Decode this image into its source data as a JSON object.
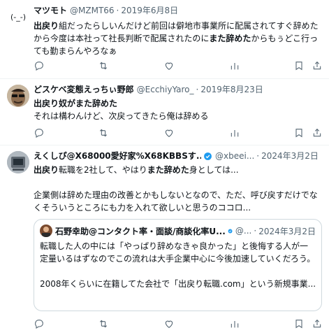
{
  "tweets": [
    {
      "display_name": "マツモト",
      "handle": "@MZMT66",
      "date": "2019年6月8日",
      "avatar_text": "(-_-)",
      "text_pre": "",
      "text_b1": "出戻り",
      "text_mid": "組だったらしいんだけど前回は僻地市事業所に配属されてすぐ辞めたから今度は本社って社長判断で配属されたのに",
      "text_b2": "また辞めた",
      "text_post": "からもぅどこ行っても勤まらんやろなぁ"
    },
    {
      "display_name": "どスケベ変態えっちぃ野郎",
      "handle": "@EcchiyYaro_",
      "date": "2019年8月23日",
      "line1_b1": "出戻り",
      "line1_mid": "奴が",
      "line1_b2": "また辞めた",
      "line2": "それは構わんけど、次戻ってきたら俺は辞める"
    },
    {
      "display_name": "えくしぴ@X68000愛好家%X68KBBSす...",
      "handle": "@xbeei...",
      "date": "2024年3月2日",
      "line1_b1": "出戻り",
      "line1_mid": "転職を2社して、やはり",
      "line1_b2": "また辞めた",
      "line1_post": "身としては...",
      "para2": "企業側は辞めた理由の改善とかもしないとなので、ただ、呼び戻すだけでなくそういうところにも力を入れて欲しいと思うのココロ...",
      "quote": {
        "display_name": "石野幸助@コンタクト率・面談/商談化率U...",
        "handle": "@...",
        "date": "2024年3月2日",
        "text1": "転職した人の中には「やっぱり辞めなきゃ良かった」と後悔する人が一定量いるはずなのでこの流れは大手企業中心に今後加速していくだろう。",
        "text2": "2008年くらいに在籍してた会社で「出戻り転職.com」という新規事業..."
      }
    }
  ],
  "dot": "·",
  "icons": [
    "reply-icon",
    "retweet-icon",
    "like-icon",
    "views-icon",
    "bookmark-icon",
    "share-icon",
    "verified-icon"
  ]
}
